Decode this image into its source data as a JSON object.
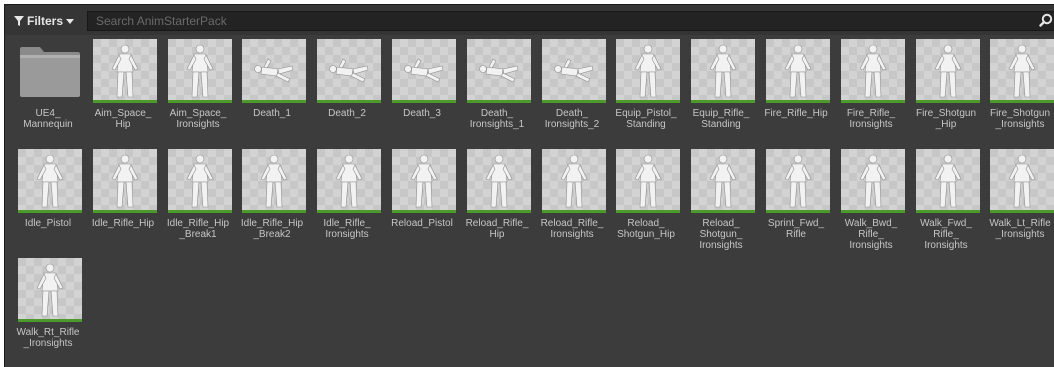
{
  "toolbar": {
    "filters_label": "Filters",
    "search_placeholder": "Search AnimStarterPack"
  },
  "icons": {
    "filter": "funnel-icon",
    "dropdown": "caret-down-icon",
    "search": "magnifier-icon",
    "folder": "folder-icon"
  },
  "colors": {
    "panel_bg": "#3c3c3c",
    "thumb_bg": "#d3d3d3",
    "anim_bar": "#4c9a2b",
    "label_text": "#c6c6c6"
  },
  "assets": [
    {
      "label": "UE4_\nMannequin",
      "kind": "folder"
    },
    {
      "label": "Aim_Space_\nHip",
      "kind": "stand"
    },
    {
      "label": "Aim_Space_\nIronsights",
      "kind": "stand"
    },
    {
      "label": "Death_1",
      "kind": "lying"
    },
    {
      "label": "Death_2",
      "kind": "lying"
    },
    {
      "label": "Death_3",
      "kind": "lying"
    },
    {
      "label": "Death_\nIronsights_1",
      "kind": "lying"
    },
    {
      "label": "Death_\nIronsights_2",
      "kind": "lying"
    },
    {
      "label": "Equip_Pistol_\nStanding",
      "kind": "stand"
    },
    {
      "label": "Equip_Rifle_\nStanding",
      "kind": "stand"
    },
    {
      "label": "Fire_Rifle_Hip",
      "kind": "stand"
    },
    {
      "label": "Fire_Rifle_\nIronsights",
      "kind": "stand"
    },
    {
      "label": "Fire_Shotgun\n_Hip",
      "kind": "stand"
    },
    {
      "label": "Fire_Shotgun\n_Ironsights",
      "kind": "stand"
    },
    {
      "label": "Idle_Pistol",
      "kind": "stand"
    },
    {
      "label": "Idle_Rifle_Hip",
      "kind": "stand"
    },
    {
      "label": "Idle_Rifle_Hip\n_Break1",
      "kind": "stand"
    },
    {
      "label": "Idle_Rifle_Hip\n_Break2",
      "kind": "stand"
    },
    {
      "label": "Idle_Rifle_\nIronsights",
      "kind": "stand"
    },
    {
      "label": "Reload_Pistol",
      "kind": "stand"
    },
    {
      "label": "Reload_Rifle_\nHip",
      "kind": "stand"
    },
    {
      "label": "Reload_Rifle_\nIronsights",
      "kind": "stand"
    },
    {
      "label": "Reload_\nShotgun_Hip",
      "kind": "stand"
    },
    {
      "label": "Reload_\nShotgun_\nIronsights",
      "kind": "stand"
    },
    {
      "label": "Sprint_Fwd_\nRifle",
      "kind": "stand"
    },
    {
      "label": "Walk_Bwd_\nRifle_\nIronsights",
      "kind": "stand"
    },
    {
      "label": "Walk_Fwd_\nRifle_\nIronsights",
      "kind": "stand"
    },
    {
      "label": "Walk_Lt_Rifle\n_Ironsights",
      "kind": "stand"
    },
    {
      "label": "Walk_Rt_Rifle\n_Ironsights",
      "kind": "stand"
    }
  ]
}
